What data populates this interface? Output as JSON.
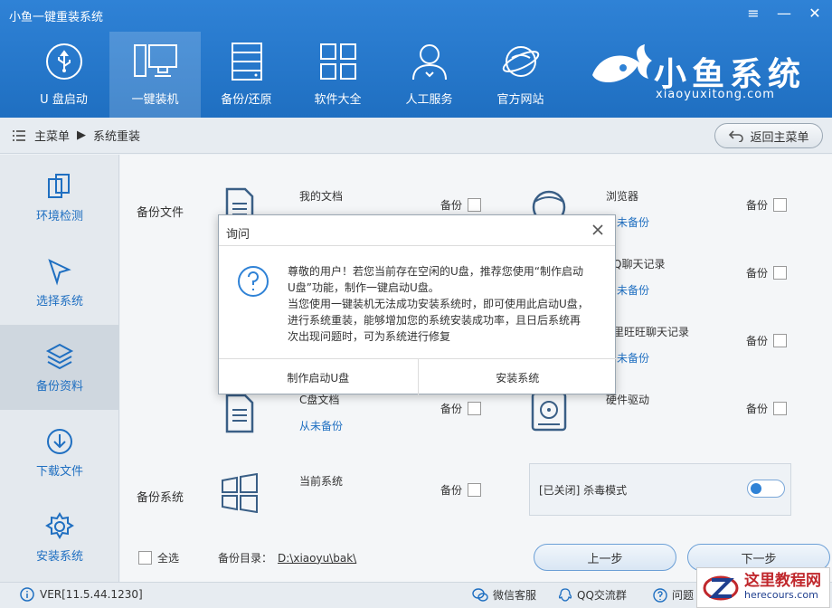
{
  "app": {
    "title": "小鱼一键重装系统"
  },
  "window_controls": {
    "menu_glyph": "≡",
    "min_glyph": "—",
    "close_glyph": "✕"
  },
  "nav": {
    "items": [
      {
        "label": "U 盘启动",
        "icon": "usb-icon"
      },
      {
        "label": "一键装机",
        "icon": "monitor-icon",
        "active": true
      },
      {
        "label": "备份/还原",
        "icon": "server-icon"
      },
      {
        "label": "软件大全",
        "icon": "grid-icon"
      },
      {
        "label": "人工服务",
        "icon": "person-icon"
      },
      {
        "label": "官方网站",
        "icon": "globe-icon"
      }
    ]
  },
  "brand": {
    "title": "小鱼系统",
    "subtitle": "xiaoyuxitong.com"
  },
  "breadcrumb": {
    "home": "主菜单",
    "current": "系统重装",
    "sep": "▶",
    "back_label": "返回主菜单"
  },
  "sidebar": {
    "items": [
      {
        "label": "环境检测",
        "icon": "copy-icon"
      },
      {
        "label": "选择系统",
        "icon": "cursor-icon"
      },
      {
        "label": "备份资料",
        "icon": "layers-icon",
        "active": true
      },
      {
        "label": "下载文件",
        "icon": "download-icon"
      },
      {
        "label": "安装系统",
        "icon": "gear-icon"
      }
    ]
  },
  "main": {
    "section_backup_files": "备份文件",
    "section_backup_system": "备份系统",
    "backup_label": "备份",
    "left_items": [
      {
        "name": "我的文档",
        "status": ""
      },
      {
        "name": "C盘文档",
        "status": "从未备份"
      },
      {
        "name": "当前系统",
        "status": ""
      }
    ],
    "right_items": [
      {
        "name": "浏览器",
        "status": "未备份"
      },
      {
        "name": "Q聊天记录",
        "status": "未备份"
      },
      {
        "name": "里旺旺聊天记录",
        "status": "未备份"
      },
      {
        "name": "硬件驱动",
        "status": ""
      }
    ],
    "antivirus": {
      "label": "[已关闭] 杀毒模式"
    },
    "select_all": "全选",
    "backup_dir_label": "备份目录：",
    "backup_dir": "D:\\xiaoyu\\bak\\",
    "prev_button": "上一步",
    "next_button": "下一步"
  },
  "dialog": {
    "title": "询问",
    "lines": [
      "尊敬的用户！若您当前存在空闲的U盘，推荐您使用“制作启动",
      "U盘”功能，制作一键启动U盘。",
      "当您使用一键装机无法成功安装系统时，即可使用此启动U盘，",
      "进行系统重装，能够增加您的系统安装成功率，且日后系统再",
      "次出现问题时，可为系统进行修复"
    ],
    "button_make_usb": "制作启动U盘",
    "button_install": "安装系统"
  },
  "footer": {
    "version": "VER[11.5.44.1230]",
    "wechat": "微信客服",
    "qq": "QQ交流群",
    "feedback": "问题"
  },
  "watermark": {
    "title": "这里教程网",
    "url": "herecours.com"
  },
  "colors": {
    "primary": "#2f82d6",
    "link": "#1f6fc1",
    "watermark_red": "#c0282d"
  }
}
